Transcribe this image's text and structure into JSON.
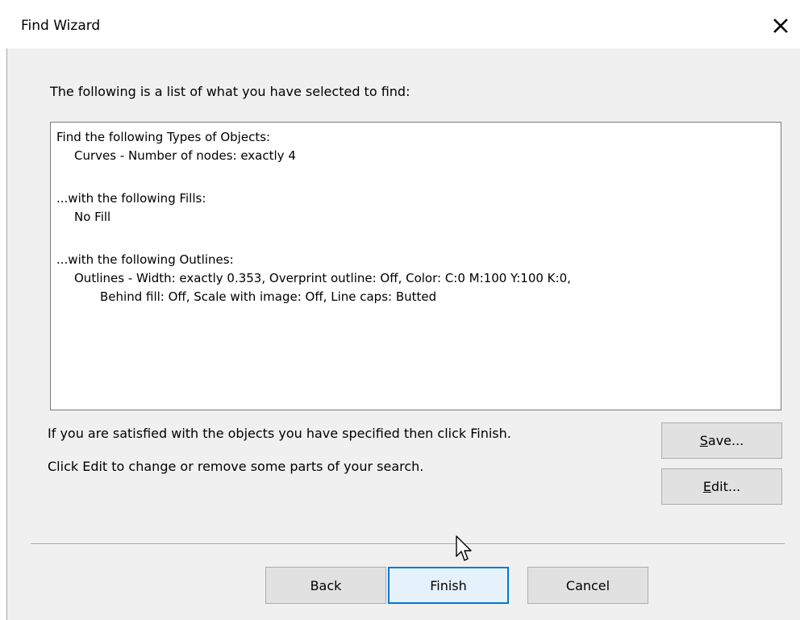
{
  "window": {
    "title": "Find Wizard"
  },
  "icons": {
    "close": "close-icon",
    "cursor": "arrow-pointer-cursor"
  },
  "colors": {
    "dialog_background": "#f0f0f0",
    "default_button_border": "#0078d7",
    "default_button_fill": "#e5f1fb"
  },
  "intro_text": "The following is a list of what you have selected to find:",
  "summary": {
    "types_heading": "Find the following Types of Objects:",
    "types_value": "Curves - Number of nodes: exactly 4",
    "fills_heading": "...with the following Fills:",
    "fills_value": "No Fill",
    "outlines_heading": "...with the following Outlines:",
    "outlines_value_line1": "Outlines -  Width: exactly 0.353, Overprint outline: Off, Color: C:0 M:100 Y:100 K:0,",
    "outlines_value_line2": "Behind fill: Off, Scale with image: Off, Line caps: Butted"
  },
  "hints": {
    "finish_hint": "If you are satisfied with the objects you have specified then click Finish.",
    "edit_hint": "Click Edit to change or remove some parts of your search."
  },
  "buttons": {
    "save": {
      "mnemonic": "S",
      "rest": "ave..."
    },
    "edit": {
      "mnemonic": "E",
      "rest": "dit..."
    },
    "back": "Back",
    "finish": "Finish",
    "cancel": "Cancel"
  }
}
